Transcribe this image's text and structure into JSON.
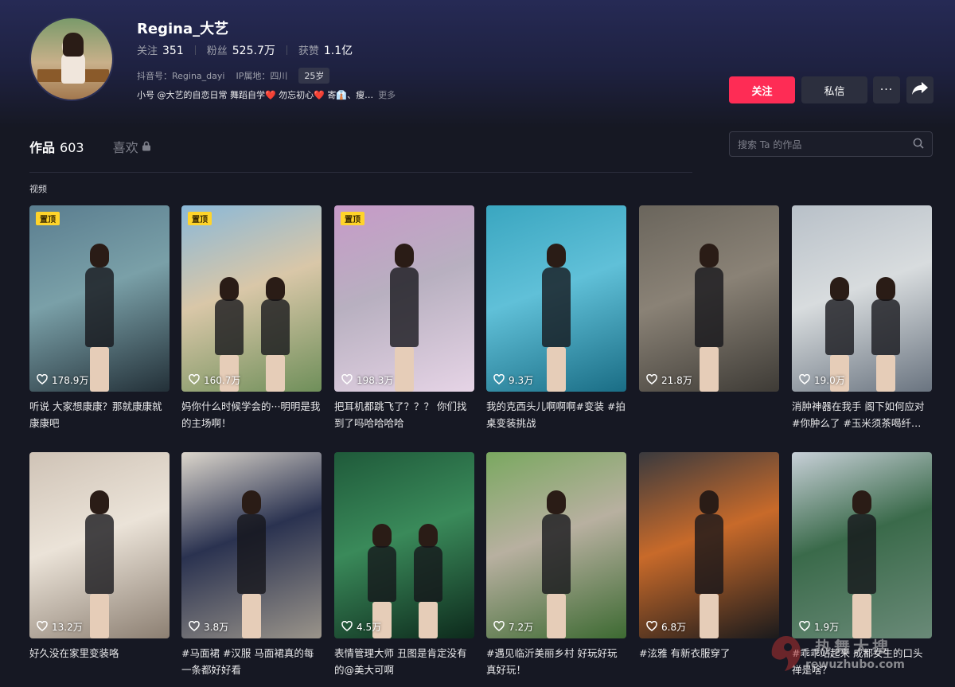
{
  "profile": {
    "name": "Regina_大艺",
    "following_label": "关注",
    "following": "351",
    "fans_label": "粉丝",
    "fans": "525.7万",
    "likes_label": "获赞",
    "likes": "1.1亿",
    "douyin_id": "抖音号：Regina_dayi",
    "ip": "IP属地：四川",
    "age": "25岁",
    "bio": "小号 @大艺的自恋日常 舞蹈自学❤️ 勿忘初心❤️ 寄👔、瘦…",
    "more": "更多"
  },
  "actions": {
    "follow": "关注",
    "message": "私信",
    "more": "···"
  },
  "tabs": {
    "works": "作品",
    "works_count": "603",
    "likes": "喜欢"
  },
  "search": {
    "placeholder": "搜索 Ta 的作品"
  },
  "section_label": "视频",
  "pin_label": "置顶",
  "videos": [
    {
      "likes": "178.9万",
      "title": "听说 大家想康康？那就康康就康康吧",
      "pinned": true,
      "colors": [
        "#5a7d8f",
        "#233038",
        "#7aa0a8"
      ]
    },
    {
      "likes": "160.7万",
      "title": "妈你什么时候学会的···明明是我的主场啊！",
      "pinned": true,
      "colors": [
        "#8ab8d8",
        "#6f8f5a",
        "#d9c7a8"
      ]
    },
    {
      "likes": "198.3万",
      "title": "把耳机都跳飞了？？？ 你们找到了吗哈哈哈哈",
      "pinned": true,
      "colors": [
        "#c79ac8",
        "#e6d4e6",
        "#b8b0c0"
      ]
    },
    {
      "likes": "9.3万",
      "title": "我的克西头儿啊啊啊#变装 #拍桌变装挑战",
      "pinned": false,
      "colors": [
        "#3aa6c0",
        "#1a6d85",
        "#60c0d8"
      ]
    },
    {
      "likes": "21.8万",
      "title": "",
      "pinned": false,
      "colors": [
        "#6a655c",
        "#3e3b36",
        "#8a8276"
      ]
    },
    {
      "likes": "19.0万",
      "title": "消肿神器在我手 阁下如何应对#你肿么了 #玉米须茶喝纤…",
      "pinned": false,
      "colors": [
        "#b8c0c8",
        "#6a7480",
        "#d8dcde"
      ]
    },
    {
      "likes": "13.2万",
      "title": "好久没在家里变装咯",
      "pinned": false,
      "colors": [
        "#cfc3b6",
        "#8c7f72",
        "#ebe3d8"
      ]
    },
    {
      "likes": "3.8万",
      "title": "#马面裙 #汉服 马面裙真的每一条都好好看",
      "pinned": false,
      "colors": [
        "#dcd6cc",
        "#9a948a",
        "#2a3250"
      ]
    },
    {
      "likes": "4.5万",
      "title": "表情管理大师 丑图是肯定没有的@美大可啊",
      "pinned": false,
      "colors": [
        "#1f5a3a",
        "#0d2a1c",
        "#3a8a5a"
      ]
    },
    {
      "likes": "7.2万",
      "title": "#遇见临沂美丽乡村 好玩好玩真好玩！",
      "pinned": false,
      "colors": [
        "#7aa860",
        "#3d6a32",
        "#b8b0a0"
      ]
    },
    {
      "likes": "6.8万",
      "title": "#泫雅 有新衣服穿了",
      "pinned": false,
      "colors": [
        "#3a3a3e",
        "#1a1a1c",
        "#c86a2a"
      ]
    },
    {
      "likes": "1.9万",
      "title": "#乖乖站起来 成都女生的口头禅是啥？",
      "pinned": false,
      "colors": [
        "#c8d0d8",
        "#6a8a78",
        "#3a6a4a"
      ]
    }
  ],
  "watermark": {
    "cn": "热舞大搜",
    "url": "rewuzhubo.com"
  }
}
